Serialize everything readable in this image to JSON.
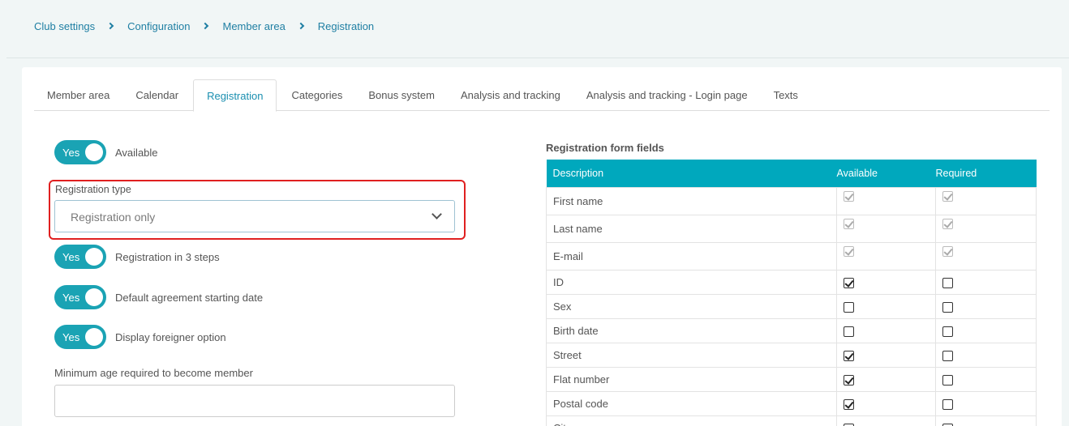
{
  "breadcrumb": [
    "Club settings",
    "Configuration",
    "Member area",
    "Registration"
  ],
  "tabs": [
    "Member area",
    "Calendar",
    "Registration",
    "Categories",
    "Bonus system",
    "Analysis and tracking",
    "Analysis and tracking - Login page",
    "Texts"
  ],
  "active_tab": "Registration",
  "toggles": [
    {
      "value": "Yes",
      "label": "Available"
    },
    {
      "value": "Yes",
      "label": "Registration in 3 steps"
    },
    {
      "value": "Yes",
      "label": "Default agreement starting date"
    },
    {
      "value": "Yes",
      "label": "Display foreigner option"
    }
  ],
  "registration_type": {
    "label": "Registration type",
    "value": "Registration only"
  },
  "min_age": {
    "label": "Minimum age required to become member",
    "value": ""
  },
  "fields_table": {
    "title": "Registration form fields",
    "headers": [
      "Description",
      "Available",
      "Required"
    ],
    "rows": [
      {
        "description": "First name",
        "available": true,
        "required": true,
        "locked": true
      },
      {
        "description": "Last name",
        "available": true,
        "required": true,
        "locked": true
      },
      {
        "description": "E-mail",
        "available": true,
        "required": true,
        "locked": true
      },
      {
        "description": "ID",
        "available": true,
        "required": false,
        "locked": false
      },
      {
        "description": "Sex",
        "available": false,
        "required": false,
        "locked": false
      },
      {
        "description": "Birth date",
        "available": false,
        "required": false,
        "locked": false
      },
      {
        "description": "Street",
        "available": true,
        "required": false,
        "locked": false
      },
      {
        "description": "Flat number",
        "available": true,
        "required": false,
        "locked": false
      },
      {
        "description": "Postal code",
        "available": true,
        "required": false,
        "locked": false
      },
      {
        "description": "City",
        "available": true,
        "required": false,
        "locked": false
      }
    ]
  },
  "colors": {
    "accent": "#00a8bd",
    "link": "#1f7fa3",
    "highlight_border": "#e02020"
  }
}
